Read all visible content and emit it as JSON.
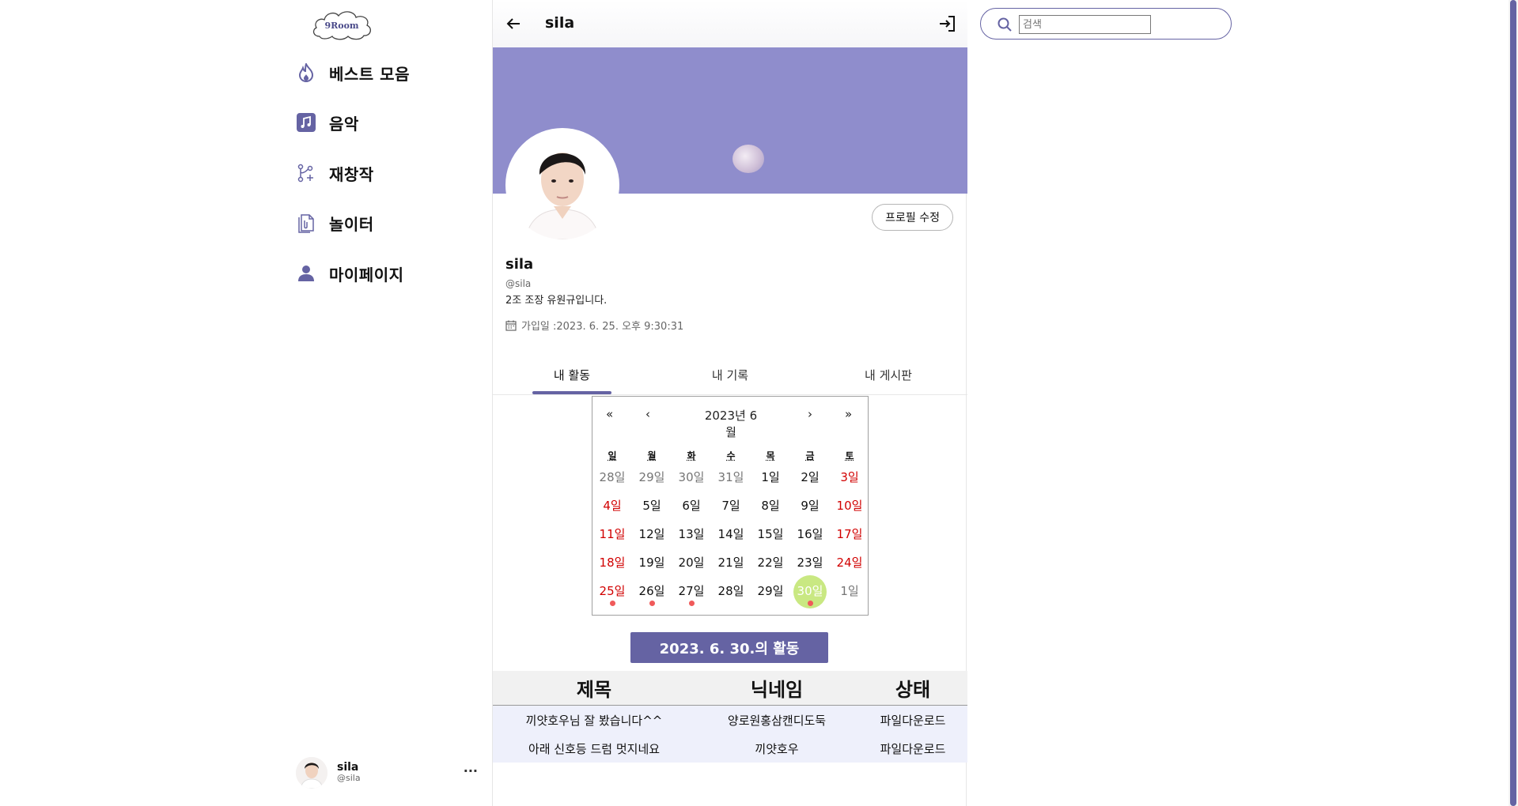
{
  "logo": {
    "text": "9Room"
  },
  "sidebar": {
    "items": [
      {
        "label": "베스트 모음",
        "icon": "fire-icon"
      },
      {
        "label": "음악",
        "icon": "music-note-icon"
      },
      {
        "label": "재창작",
        "icon": "git-merge-icon"
      },
      {
        "label": "놀이터",
        "icon": "documents-icon"
      },
      {
        "label": "마이페이지",
        "icon": "person-icon"
      }
    ],
    "user": {
      "name": "sila",
      "handle": "@sila",
      "more": "···"
    }
  },
  "topbar": {
    "title": "sila"
  },
  "profile": {
    "edit_label": "프로필 수정",
    "name": "sila",
    "handle": "@sila",
    "bio": "2조 조장 유원규입니다.",
    "joined": "가입일 :2023. 6. 25. 오후 9:30:31"
  },
  "tabs": [
    {
      "label": "내 활동",
      "active": true
    },
    {
      "label": "내 기록",
      "active": false
    },
    {
      "label": "내 게시판",
      "active": false
    }
  ],
  "calendar": {
    "nav": {
      "prev_year": "«",
      "prev_month": "‹",
      "title": "2023년 6월",
      "next_month": "›",
      "next_year": "»"
    },
    "weekdays": [
      "일",
      "월",
      "화",
      "수",
      "목",
      "금",
      "토"
    ],
    "weeks": [
      [
        "28일",
        "29일",
        "30일",
        "31일",
        "1일",
        "2일",
        "3일"
      ],
      [
        "4일",
        "5일",
        "6일",
        "7일",
        "8일",
        "9일",
        "10일"
      ],
      [
        "11일",
        "12일",
        "13일",
        "14일",
        "15일",
        "16일",
        "17일"
      ],
      [
        "18일",
        "19일",
        "20일",
        "21일",
        "22일",
        "23일",
        "24일"
      ],
      [
        "25일",
        "26일",
        "27일",
        "28일",
        "29일",
        "30일",
        "1일"
      ]
    ],
    "selected": "30일"
  },
  "activity": {
    "button_label": "2023. 6. 30.의 활동",
    "headers": [
      "제목",
      "닉네임",
      "상태"
    ],
    "rows": [
      [
        "끼얏호우님 잘 봤습니다^^",
        "양로원홍삼캔디도둑",
        "파일다운로드"
      ],
      [
        "아래 신호등 드럼 멋지네요",
        "끼얏호우",
        "파일다운로드"
      ]
    ]
  },
  "search": {
    "placeholder": "검색"
  },
  "colors": {
    "accent": "#6563a3",
    "banner": "#8f8dcc",
    "selected_day": "#c9e882",
    "weekend": "#d10000",
    "activity_dot": "#f05a5a"
  }
}
